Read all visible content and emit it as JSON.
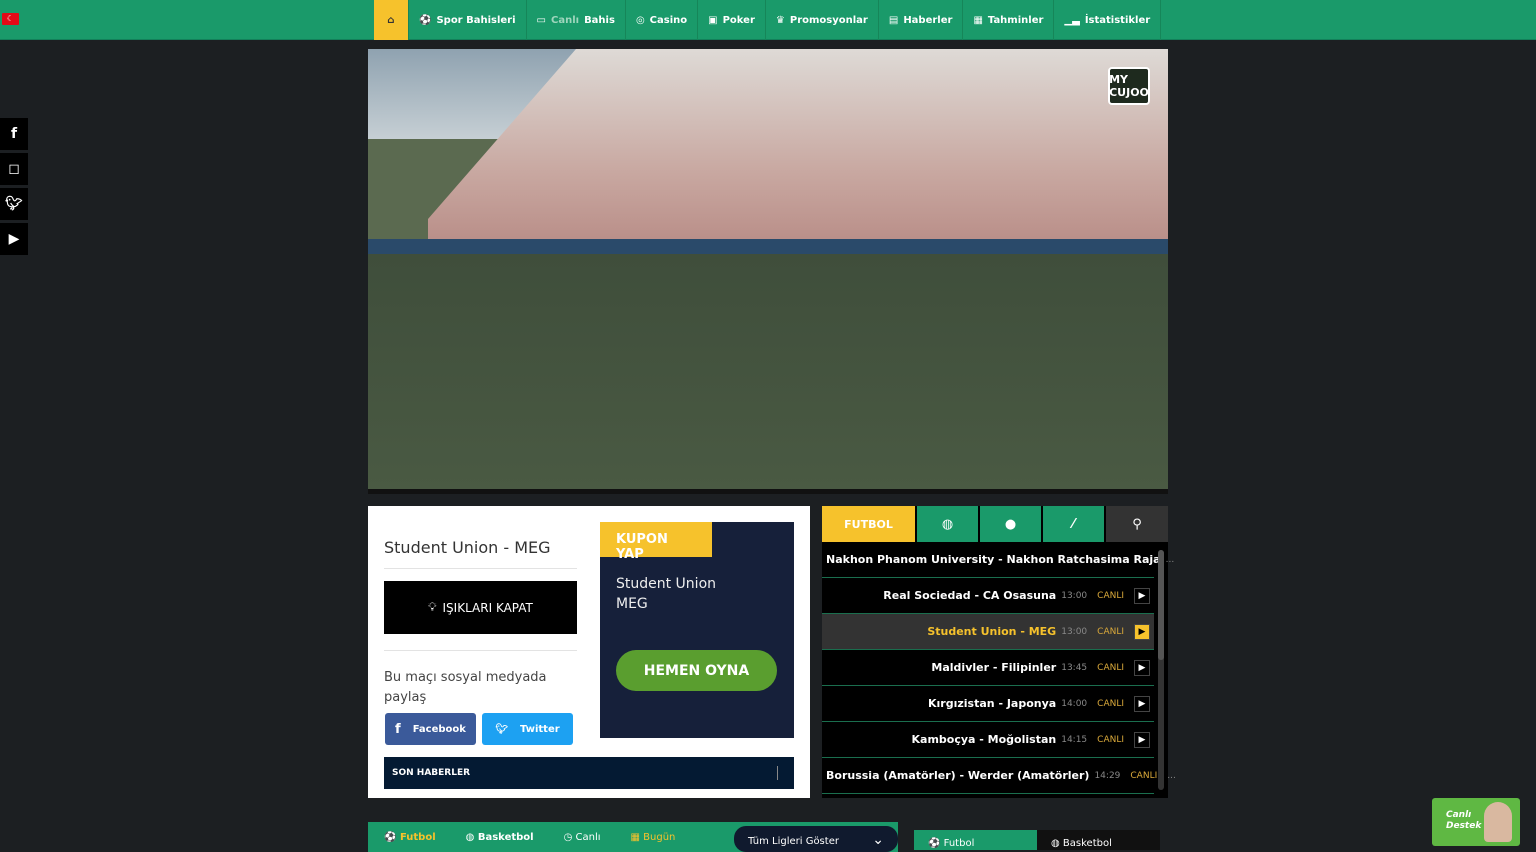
{
  "nav": {
    "items": [
      {
        "label": "Spor Bahisleri",
        "icon": "soccer-ball-icon"
      },
      {
        "label_dim": "Canlı",
        "label": "Bahis",
        "icon": "monitor-icon"
      },
      {
        "label": "Casino",
        "icon": "roulette-icon"
      },
      {
        "label": "Poker",
        "icon": "cards-icon"
      },
      {
        "label": "Promosyonlar",
        "icon": "crown-icon"
      },
      {
        "label": "Haberler",
        "icon": "news-icon"
      },
      {
        "label": "Tahminler",
        "icon": "chart-icon"
      },
      {
        "label": "İstatistikler",
        "icon": "bar-chart-icon"
      }
    ]
  },
  "video": {
    "logo": "MY CUJOO"
  },
  "match": {
    "title": "Student Union - MEG",
    "lights_label": "IŞIKLARI KAPAT",
    "share_text": "Bu maçı sosyal medyada paylaş",
    "facebook": "Facebook",
    "twitter": "Twitter"
  },
  "kupon": {
    "tag": "KUPON YAP",
    "team1": "Student Union",
    "team2": "MEG",
    "play": "HEMEN OYNA"
  },
  "news": {
    "title": "SON HABERLER"
  },
  "sports_tabs": {
    "futbol": "FUTBOL"
  },
  "matches": [
    {
      "name": "Nakhon Phanom University - Nakhon Ratchasima Raja",
      "time": "",
      "status": "",
      "more": "..."
    },
    {
      "name": "Real Sociedad - CA Osasuna",
      "time": "13:00",
      "status": "CANLI"
    },
    {
      "name": "Student Union - MEG",
      "time": "13:00",
      "status": "CANLI",
      "active": true
    },
    {
      "name": "Maldivler - Filipinler",
      "time": "13:45",
      "status": "CANLI"
    },
    {
      "name": "Kırgızistan - Japonya",
      "time": "14:00",
      "status": "CANLI"
    },
    {
      "name": "Kamboçya - Moğolistan",
      "time": "14:15",
      "status": "CANLI"
    },
    {
      "name": "Borussia (Amatörler) - Werder (Amatörler)",
      "time": "14:29",
      "status": "CANLI",
      "more": "..."
    }
  ],
  "bottom": {
    "futbol": "Futbol",
    "basketbol": "Basketbol",
    "canli": "Canlı",
    "bugun": "Bugün",
    "leagues": "Tüm Ligleri Göster",
    "tab1": "Futbol",
    "tab2": "Basketbol"
  },
  "support": {
    "line1": "Canlı",
    "line2": "Destek"
  },
  "colors": {
    "green": "#1a9a6a",
    "yellow": "#f6c22c",
    "navy": "#16203a"
  }
}
